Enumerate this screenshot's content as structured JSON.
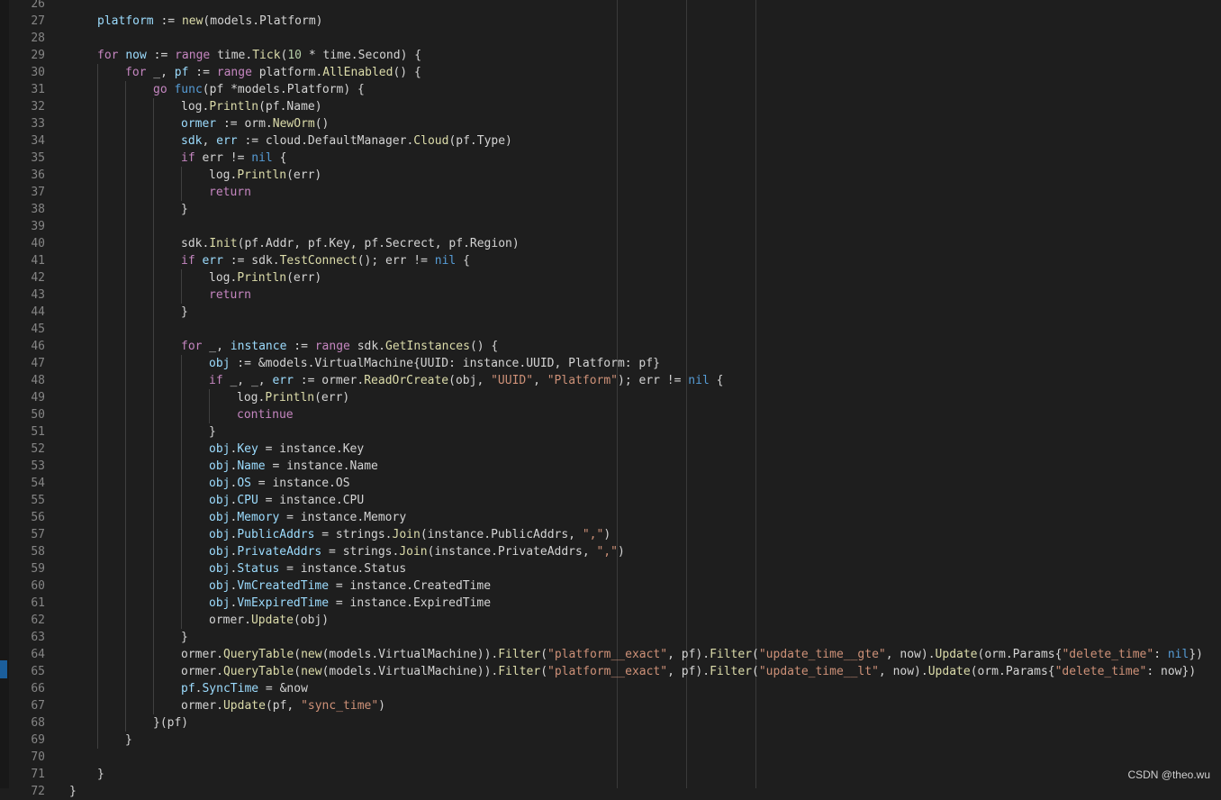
{
  "editor": {
    "language": "go",
    "colors": {
      "background": "#1e1e1e",
      "line_number": "#858585",
      "keyword": "#c586c0",
      "builtin": "#569cd6",
      "function": "#dcdcaa",
      "variable": "#9cdcfe",
      "string": "#ce9178",
      "number": "#b5cea8",
      "plain": "#d4d4d4"
    },
    "lines": [
      {
        "number": "26",
        "indent": 0,
        "tokens": []
      },
      {
        "number": "27",
        "indent": 1,
        "tokens": [
          [
            "v",
            "platform"
          ],
          [
            "p",
            " := "
          ],
          [
            "f",
            "new"
          ],
          [
            "p",
            "(models.Platform)"
          ]
        ]
      },
      {
        "number": "28",
        "indent": 0,
        "tokens": []
      },
      {
        "number": "29",
        "indent": 1,
        "tokens": [
          [
            "k",
            "for"
          ],
          [
            "p",
            " "
          ],
          [
            "v",
            "now"
          ],
          [
            "p",
            " := "
          ],
          [
            "k",
            "range"
          ],
          [
            "p",
            " time."
          ],
          [
            "f",
            "Tick"
          ],
          [
            "p",
            "("
          ],
          [
            "n",
            "10"
          ],
          [
            "p",
            " * time.Second) {"
          ]
        ]
      },
      {
        "number": "30",
        "indent": 2,
        "tokens": [
          [
            "k",
            "for"
          ],
          [
            "p",
            " _, "
          ],
          [
            "v",
            "pf"
          ],
          [
            "p",
            " := "
          ],
          [
            "k",
            "range"
          ],
          [
            "p",
            " platform."
          ],
          [
            "f",
            "AllEnabled"
          ],
          [
            "p",
            "() {"
          ]
        ]
      },
      {
        "number": "31",
        "indent": 3,
        "tokens": [
          [
            "k",
            "go"
          ],
          [
            "p",
            " "
          ],
          [
            "kb",
            "func"
          ],
          [
            "p",
            "(pf *models.Platform) {"
          ]
        ]
      },
      {
        "number": "32",
        "indent": 4,
        "tokens": [
          [
            "p",
            "log."
          ],
          [
            "f",
            "Println"
          ],
          [
            "p",
            "(pf.Name)"
          ]
        ]
      },
      {
        "number": "33",
        "indent": 4,
        "tokens": [
          [
            "v",
            "ormer"
          ],
          [
            "p",
            " := orm."
          ],
          [
            "f",
            "NewOrm"
          ],
          [
            "p",
            "()"
          ]
        ]
      },
      {
        "number": "34",
        "indent": 4,
        "tokens": [
          [
            "v",
            "sdk"
          ],
          [
            "p",
            ", "
          ],
          [
            "v",
            "err"
          ],
          [
            "p",
            " := cloud.DefaultManager."
          ],
          [
            "f",
            "Cloud"
          ],
          [
            "p",
            "(pf.Type)"
          ]
        ]
      },
      {
        "number": "35",
        "indent": 4,
        "tokens": [
          [
            "k",
            "if"
          ],
          [
            "p",
            " err != "
          ],
          [
            "kb",
            "nil"
          ],
          [
            "p",
            " {"
          ]
        ]
      },
      {
        "number": "36",
        "indent": 5,
        "tokens": [
          [
            "p",
            "log."
          ],
          [
            "f",
            "Println"
          ],
          [
            "p",
            "(err)"
          ]
        ]
      },
      {
        "number": "37",
        "indent": 5,
        "tokens": [
          [
            "k",
            "return"
          ]
        ]
      },
      {
        "number": "38",
        "indent": 4,
        "tokens": [
          [
            "p",
            "}"
          ]
        ]
      },
      {
        "number": "39",
        "indent": 0,
        "tokens": []
      },
      {
        "number": "40",
        "indent": 4,
        "tokens": [
          [
            "p",
            "sdk."
          ],
          [
            "f",
            "Init"
          ],
          [
            "p",
            "(pf.Addr, pf.Key, pf.Secrect, pf.Region)"
          ]
        ]
      },
      {
        "number": "41",
        "indent": 4,
        "tokens": [
          [
            "k",
            "if"
          ],
          [
            "p",
            " "
          ],
          [
            "v",
            "err"
          ],
          [
            "p",
            " := sdk."
          ],
          [
            "f",
            "TestConnect"
          ],
          [
            "p",
            "(); err != "
          ],
          [
            "kb",
            "nil"
          ],
          [
            "p",
            " {"
          ]
        ]
      },
      {
        "number": "42",
        "indent": 5,
        "tokens": [
          [
            "p",
            "log."
          ],
          [
            "f",
            "Println"
          ],
          [
            "p",
            "(err)"
          ]
        ]
      },
      {
        "number": "43",
        "indent": 5,
        "tokens": [
          [
            "k",
            "return"
          ]
        ]
      },
      {
        "number": "44",
        "indent": 4,
        "tokens": [
          [
            "p",
            "}"
          ]
        ]
      },
      {
        "number": "45",
        "indent": 0,
        "tokens": []
      },
      {
        "number": "46",
        "indent": 4,
        "tokens": [
          [
            "k",
            "for"
          ],
          [
            "p",
            " _, "
          ],
          [
            "v",
            "instance"
          ],
          [
            "p",
            " := "
          ],
          [
            "k",
            "range"
          ],
          [
            "p",
            " sdk."
          ],
          [
            "f",
            "GetInstances"
          ],
          [
            "p",
            "() {"
          ]
        ]
      },
      {
        "number": "47",
        "indent": 5,
        "tokens": [
          [
            "v",
            "obj"
          ],
          [
            "p",
            " := &models.VirtualMachine{UUID: instance.UUID, Platform: pf}"
          ]
        ]
      },
      {
        "number": "48",
        "indent": 5,
        "tokens": [
          [
            "k",
            "if"
          ],
          [
            "p",
            " _, _, "
          ],
          [
            "v",
            "err"
          ],
          [
            "p",
            " := ormer."
          ],
          [
            "f",
            "ReadOrCreate"
          ],
          [
            "p",
            "(obj, "
          ],
          [
            "s",
            "\"UUID\""
          ],
          [
            "p",
            ", "
          ],
          [
            "s",
            "\"Platform\""
          ],
          [
            "p",
            "); err != "
          ],
          [
            "kb",
            "nil"
          ],
          [
            "p",
            " {"
          ]
        ]
      },
      {
        "number": "49",
        "indent": 6,
        "tokens": [
          [
            "p",
            "log."
          ],
          [
            "f",
            "Println"
          ],
          [
            "p",
            "(err)"
          ]
        ]
      },
      {
        "number": "50",
        "indent": 6,
        "tokens": [
          [
            "k",
            "continue"
          ]
        ]
      },
      {
        "number": "51",
        "indent": 5,
        "tokens": [
          [
            "p",
            "}"
          ]
        ]
      },
      {
        "number": "52",
        "indent": 5,
        "tokens": [
          [
            "v",
            "obj"
          ],
          [
            "p",
            "."
          ],
          [
            "v",
            "Key"
          ],
          [
            "p",
            " = instance.Key"
          ]
        ]
      },
      {
        "number": "53",
        "indent": 5,
        "tokens": [
          [
            "v",
            "obj"
          ],
          [
            "p",
            "."
          ],
          [
            "v",
            "Name"
          ],
          [
            "p",
            " = instance.Name"
          ]
        ]
      },
      {
        "number": "54",
        "indent": 5,
        "tokens": [
          [
            "v",
            "obj"
          ],
          [
            "p",
            "."
          ],
          [
            "v",
            "OS"
          ],
          [
            "p",
            " = instance.OS"
          ]
        ]
      },
      {
        "number": "55",
        "indent": 5,
        "tokens": [
          [
            "v",
            "obj"
          ],
          [
            "p",
            "."
          ],
          [
            "v",
            "CPU"
          ],
          [
            "p",
            " = instance.CPU"
          ]
        ]
      },
      {
        "number": "56",
        "indent": 5,
        "tokens": [
          [
            "v",
            "obj"
          ],
          [
            "p",
            "."
          ],
          [
            "v",
            "Memory"
          ],
          [
            "p",
            " = instance.Memory"
          ]
        ]
      },
      {
        "number": "57",
        "indent": 5,
        "tokens": [
          [
            "v",
            "obj"
          ],
          [
            "p",
            "."
          ],
          [
            "v",
            "PublicAddrs"
          ],
          [
            "p",
            " = strings."
          ],
          [
            "f",
            "Join"
          ],
          [
            "p",
            "(instance.PublicAddrs, "
          ],
          [
            "s",
            "\",\""
          ],
          [
            "p",
            ")"
          ]
        ]
      },
      {
        "number": "58",
        "indent": 5,
        "tokens": [
          [
            "v",
            "obj"
          ],
          [
            "p",
            "."
          ],
          [
            "v",
            "PrivateAddrs"
          ],
          [
            "p",
            " = strings."
          ],
          [
            "f",
            "Join"
          ],
          [
            "p",
            "(instance.PrivateAddrs, "
          ],
          [
            "s",
            "\",\""
          ],
          [
            "p",
            ")"
          ]
        ]
      },
      {
        "number": "59",
        "indent": 5,
        "tokens": [
          [
            "v",
            "obj"
          ],
          [
            "p",
            "."
          ],
          [
            "v",
            "Status"
          ],
          [
            "p",
            " = instance.Status"
          ]
        ]
      },
      {
        "number": "60",
        "indent": 5,
        "tokens": [
          [
            "v",
            "obj"
          ],
          [
            "p",
            "."
          ],
          [
            "v",
            "VmCreatedTime"
          ],
          [
            "p",
            " = instance.CreatedTime"
          ]
        ]
      },
      {
        "number": "61",
        "indent": 5,
        "tokens": [
          [
            "v",
            "obj"
          ],
          [
            "p",
            "."
          ],
          [
            "v",
            "VmExpiredTime"
          ],
          [
            "p",
            " = instance.ExpiredTime"
          ]
        ]
      },
      {
        "number": "62",
        "indent": 5,
        "tokens": [
          [
            "p",
            "ormer."
          ],
          [
            "f",
            "Update"
          ],
          [
            "p",
            "(obj)"
          ]
        ]
      },
      {
        "number": "63",
        "indent": 4,
        "tokens": [
          [
            "p",
            "}"
          ]
        ]
      },
      {
        "number": "64",
        "indent": 4,
        "tokens": [
          [
            "p",
            "ormer."
          ],
          [
            "f",
            "QueryTable"
          ],
          [
            "p",
            "("
          ],
          [
            "f",
            "new"
          ],
          [
            "p",
            "(models.VirtualMachine))."
          ],
          [
            "f",
            "Filter"
          ],
          [
            "p",
            "("
          ],
          [
            "s",
            "\"platform__exact\""
          ],
          [
            "p",
            ", pf)."
          ],
          [
            "f",
            "Filter"
          ],
          [
            "p",
            "("
          ],
          [
            "s",
            "\"update_time__gte\""
          ],
          [
            "p",
            ", now)."
          ],
          [
            "f",
            "Update"
          ],
          [
            "p",
            "(orm.Params{"
          ],
          [
            "s",
            "\"delete_time\""
          ],
          [
            "p",
            ": "
          ],
          [
            "kb",
            "nil"
          ],
          [
            "p",
            "})"
          ]
        ]
      },
      {
        "number": "65",
        "indent": 4,
        "tokens": [
          [
            "p",
            "ormer."
          ],
          [
            "f",
            "QueryTable"
          ],
          [
            "p",
            "("
          ],
          [
            "f",
            "new"
          ],
          [
            "p",
            "(models.VirtualMachine))."
          ],
          [
            "f",
            "Filter"
          ],
          [
            "p",
            "("
          ],
          [
            "s",
            "\"platform__exact\""
          ],
          [
            "p",
            ", pf)."
          ],
          [
            "f",
            "Filter"
          ],
          [
            "p",
            "("
          ],
          [
            "s",
            "\"update_time__lt\""
          ],
          [
            "p",
            ", now)."
          ],
          [
            "f",
            "Update"
          ],
          [
            "p",
            "(orm.Params{"
          ],
          [
            "s",
            "\"delete_time\""
          ],
          [
            "p",
            ": now})"
          ]
        ]
      },
      {
        "number": "66",
        "indent": 4,
        "tokens": [
          [
            "v",
            "pf"
          ],
          [
            "p",
            "."
          ],
          [
            "v",
            "SyncTime"
          ],
          [
            "p",
            " = &now"
          ]
        ]
      },
      {
        "number": "67",
        "indent": 4,
        "tokens": [
          [
            "p",
            "ormer."
          ],
          [
            "f",
            "Update"
          ],
          [
            "p",
            "(pf, "
          ],
          [
            "s",
            "\"sync_time\""
          ],
          [
            "p",
            ")"
          ]
        ]
      },
      {
        "number": "68",
        "indent": 3,
        "tokens": [
          [
            "p",
            "}(pf)"
          ]
        ]
      },
      {
        "number": "69",
        "indent": 2,
        "tokens": [
          [
            "p",
            "}"
          ]
        ]
      },
      {
        "number": "70",
        "indent": 0,
        "tokens": []
      },
      {
        "number": "71",
        "indent": 1,
        "tokens": [
          [
            "p",
            "}"
          ]
        ]
      },
      {
        "number": "72",
        "indent": 0,
        "tokens": [
          [
            "p",
            "}"
          ]
        ]
      }
    ]
  },
  "watermark": "CSDN @theo.wu"
}
